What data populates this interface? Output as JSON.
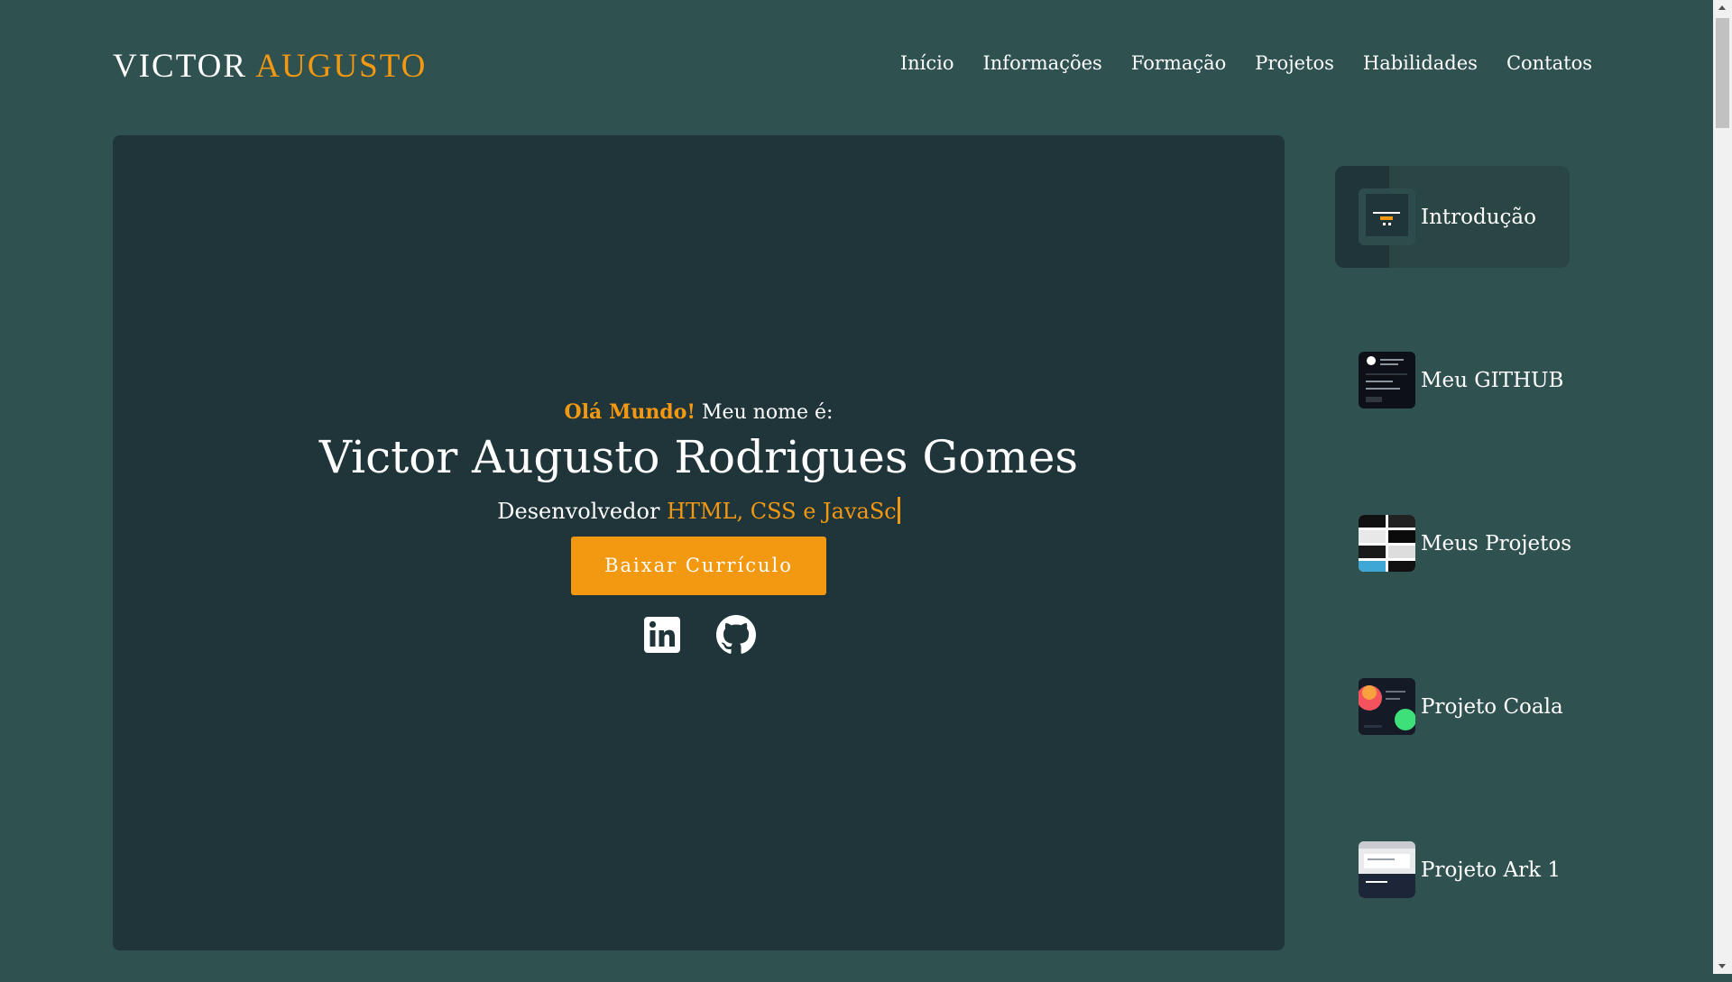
{
  "header": {
    "logo_first": "VICTOR",
    "logo_second": "AUGUSTO",
    "nav": [
      "Início",
      "Informações",
      "Formação",
      "Projetos",
      "Habilidades",
      "Contatos"
    ]
  },
  "hero": {
    "greeting_highlight": "Olá Mundo!",
    "greeting_rest": "Meu nome é:",
    "name": "Victor Augusto Rodrigues Gomes",
    "role_prefix": "Desenvolvedor",
    "role_typed": "HTML, CSS e JavaSc",
    "cv_button": "Baixar Currículo",
    "socials": [
      "linkedin-icon",
      "github-icon"
    ]
  },
  "side": {
    "items": [
      "Introdução",
      "Meu GITHUB",
      "Meus Projetos",
      "Projeto Coala",
      "Projeto Ark 1"
    ],
    "active_index": 0
  },
  "colors": {
    "background": "#2f5150",
    "panel": "#20353a",
    "accent": "#f29811"
  }
}
